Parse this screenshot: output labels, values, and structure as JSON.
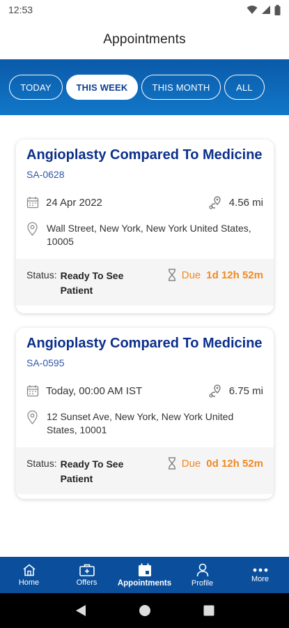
{
  "status_bar": {
    "time": "12:53"
  },
  "header": {
    "title": "Appointments"
  },
  "filters": [
    {
      "label": "TODAY",
      "active": false
    },
    {
      "label": "THIS WEEK",
      "active": true
    },
    {
      "label": "THIS MONTH",
      "active": false
    },
    {
      "label": "ALL",
      "active": false
    }
  ],
  "appointments": [
    {
      "title": "Angioplasty Compared To Medicine",
      "id": "SA-0628",
      "date": "24 Apr 2022",
      "distance": "4.56 mi",
      "address": "Wall Street, New York, New York United States, 10005",
      "status_label": "Status:",
      "status_value": "Ready To See Patient",
      "due_label": "Due",
      "due_value": "1d 12h 52m"
    },
    {
      "title": "Angioplasty Compared To Medicine",
      "id": "SA-0595",
      "date": "Today, 00:00 AM IST",
      "distance": "6.75 mi",
      "address": "12 Sunset Ave, New York, New York United States, 10001",
      "status_label": "Status:",
      "status_value": "Ready To See Patient",
      "due_label": "Due",
      "due_value": "0d 12h 52m"
    }
  ],
  "bottom_nav": [
    {
      "label": "Home",
      "icon": "home-icon"
    },
    {
      "label": "Offers",
      "icon": "offers-icon"
    },
    {
      "label": "Appointments",
      "icon": "calendar-icon",
      "active": true
    },
    {
      "label": "Profile",
      "icon": "profile-icon"
    },
    {
      "label": "More",
      "icon": "more-icon"
    }
  ],
  "colors": {
    "brand_blue": "#0b4f9c",
    "title_blue": "#0b2f8a",
    "due_orange": "#f08a24"
  }
}
